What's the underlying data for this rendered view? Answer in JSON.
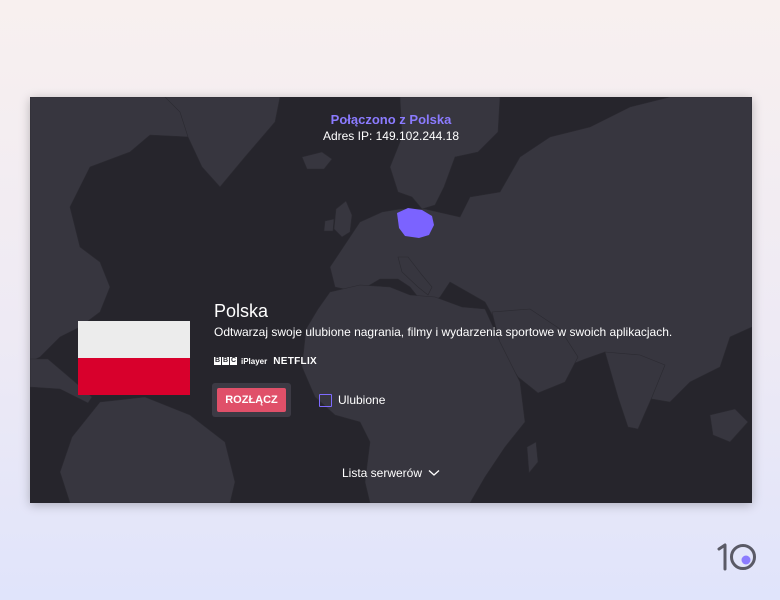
{
  "status": {
    "connected_text": "Połączono z Polska",
    "ip_text": "Adres IP: 149.102.244.18"
  },
  "country": {
    "name": "Polska",
    "description": "Odtwarzaj swoje ulubione nagrania, filmy i wydarzenia sportowe w swoich aplikacjach.",
    "flag_colors": [
      "#ececec",
      "#d8002c"
    ],
    "highlight_color": "#7b63ff"
  },
  "services": {
    "bbc_letters": [
      "B",
      "B",
      "C"
    ],
    "iplayer": "iPlayer",
    "netflix": "NETFLIX"
  },
  "actions": {
    "disconnect_label": "ROZŁĄCZ",
    "favorite_label": "Ulubione",
    "favorite_checked": false
  },
  "footer": {
    "server_list_label": "Lista serwerów"
  },
  "brand": {
    "logo_text": "10"
  },
  "colors": {
    "map_background": "#26252c",
    "land": "#37363f",
    "accent": "#8b7bff",
    "disconnect": "#e05069"
  }
}
